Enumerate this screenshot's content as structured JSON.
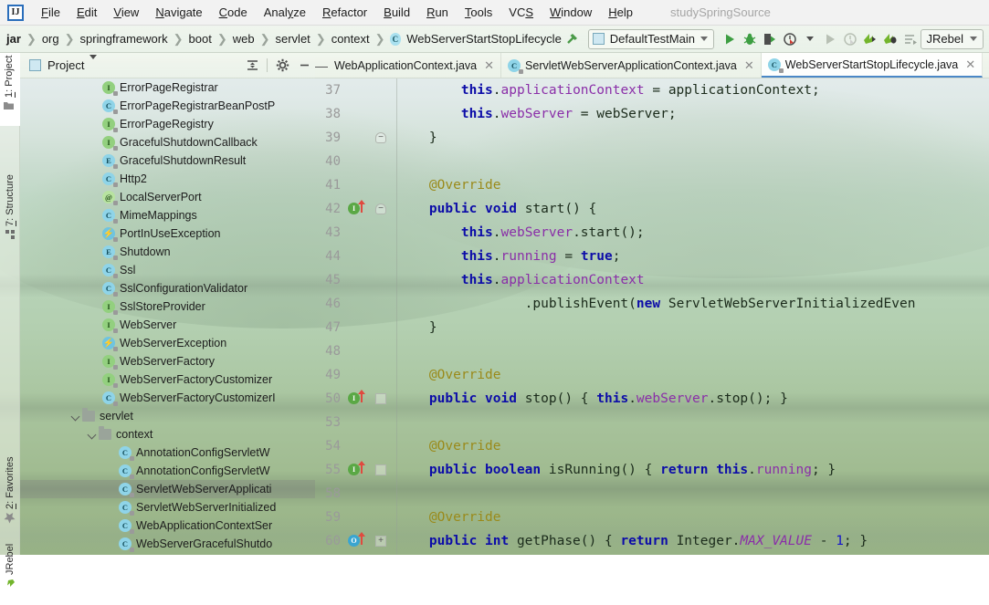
{
  "window": {
    "title": "studySpringSource",
    "logo_text": "IJ"
  },
  "menubar": {
    "items": [
      {
        "label": "File",
        "mnemonic": "F"
      },
      {
        "label": "Edit",
        "mnemonic": "E"
      },
      {
        "label": "View",
        "mnemonic": "V"
      },
      {
        "label": "Navigate",
        "mnemonic": "N"
      },
      {
        "label": "Code",
        "mnemonic": "C"
      },
      {
        "label": "Analyze",
        "mnemonic": "y"
      },
      {
        "label": "Refactor",
        "mnemonic": "R"
      },
      {
        "label": "Build",
        "mnemonic": "B"
      },
      {
        "label": "Run",
        "mnemonic": "R"
      },
      {
        "label": "Tools",
        "mnemonic": "T"
      },
      {
        "label": "VCS",
        "mnemonic": "S"
      },
      {
        "label": "Window",
        "mnemonic": "W"
      },
      {
        "label": "Help",
        "mnemonic": "H"
      }
    ]
  },
  "navbar": {
    "breadcrumbs": [
      "jar",
      "org",
      "springframework",
      "boot",
      "web",
      "servlet",
      "context"
    ],
    "current_file": "WebServerStartStopLifecycle",
    "current_file_icon": "C",
    "run_config": {
      "name": "DefaultTestMain",
      "icon": "run-config-icon"
    },
    "jrebel": {
      "label": "JRebel"
    },
    "buttons": [
      {
        "name": "build-hammer-icon",
        "label": "Build"
      },
      {
        "name": "run-button",
        "label": "Run"
      },
      {
        "name": "debug-button",
        "label": "Debug"
      },
      {
        "name": "run-coverage-button",
        "label": "Run with Coverage"
      },
      {
        "name": "profiler-button",
        "label": "Profiler"
      },
      {
        "name": "rerun-button",
        "label": "Rerun"
      },
      {
        "name": "attach-profiler-button",
        "label": "Attach Profiler"
      },
      {
        "name": "jrebel-run-button",
        "label": "Run with JRebel"
      },
      {
        "name": "jrebel-debug-button",
        "label": "Debug with JRebel"
      },
      {
        "name": "stop-all-button",
        "label": "Stop"
      }
    ]
  },
  "stripe": {
    "buttons": [
      {
        "label": "1: Project",
        "mnemonic": "1",
        "icon": "project-icon",
        "active": true
      },
      {
        "label": "7: Structure",
        "mnemonic": "7",
        "icon": "structure-icon",
        "active": false
      },
      {
        "label": "2: Favorites",
        "mnemonic": "2",
        "icon": "star-icon",
        "active": false
      },
      {
        "label": "JRebel",
        "mnemonic": "",
        "icon": "jrebel-icon",
        "active": false
      }
    ]
  },
  "project_panel": {
    "title": "Project",
    "toolbar": [
      {
        "name": "collapse-all-icon",
        "label": "Collapse All"
      },
      {
        "name": "gear-icon",
        "label": "Settings"
      },
      {
        "name": "hide-icon",
        "label": "Hide"
      }
    ],
    "tree": [
      {
        "label": "ErrorPageRegistrar",
        "icon": "I",
        "indent": 5,
        "type": "interface"
      },
      {
        "label": "ErrorPageRegistrarBeanPostP",
        "icon": "C",
        "indent": 5,
        "type": "class"
      },
      {
        "label": "ErrorPageRegistry",
        "icon": "I",
        "indent": 5,
        "type": "interface"
      },
      {
        "label": "GracefulShutdownCallback",
        "icon": "I",
        "indent": 5,
        "type": "interface"
      },
      {
        "label": "GracefulShutdownResult",
        "icon": "E",
        "indent": 5,
        "type": "enum"
      },
      {
        "label": "Http2",
        "icon": "C",
        "indent": 5,
        "type": "class"
      },
      {
        "label": "LocalServerPort",
        "icon": "@",
        "indent": 5,
        "type": "annotation"
      },
      {
        "label": "MimeMappings",
        "icon": "C",
        "indent": 5,
        "type": "class"
      },
      {
        "label": "PortInUseException",
        "icon": "X",
        "indent": 5,
        "type": "exception"
      },
      {
        "label": "Shutdown",
        "icon": "E",
        "indent": 5,
        "type": "enum"
      },
      {
        "label": "Ssl",
        "icon": "C",
        "indent": 5,
        "type": "class"
      },
      {
        "label": "SslConfigurationValidator",
        "icon": "C",
        "indent": 5,
        "type": "class"
      },
      {
        "label": "SslStoreProvider",
        "icon": "I",
        "indent": 5,
        "type": "interface"
      },
      {
        "label": "WebServer",
        "icon": "I",
        "indent": 5,
        "type": "interface"
      },
      {
        "label": "WebServerException",
        "icon": "X",
        "indent": 5,
        "type": "exception"
      },
      {
        "label": "WebServerFactory",
        "icon": "I",
        "indent": 5,
        "type": "interface"
      },
      {
        "label": "WebServerFactoryCustomizer",
        "icon": "I",
        "indent": 5,
        "type": "interface"
      },
      {
        "label": "WebServerFactoryCustomizerI",
        "icon": "C",
        "indent": 5,
        "type": "class"
      },
      {
        "label": "servlet",
        "icon": "folder",
        "indent": 3,
        "type": "folder",
        "expanded": true
      },
      {
        "label": "context",
        "icon": "folder",
        "indent": 4,
        "type": "folder",
        "expanded": true
      },
      {
        "label": "AnnotationConfigServletW",
        "icon": "C",
        "indent": 6,
        "type": "class"
      },
      {
        "label": "AnnotationConfigServletW",
        "icon": "C",
        "indent": 6,
        "type": "class"
      },
      {
        "label": "ServletWebServerApplicati",
        "icon": "C",
        "indent": 6,
        "type": "class",
        "selected": true
      },
      {
        "label": "ServletWebServerInitialized",
        "icon": "C",
        "indent": 6,
        "type": "class"
      },
      {
        "label": "WebApplicationContextSer",
        "icon": "C",
        "indent": 6,
        "type": "class"
      },
      {
        "label": "WebServerGracefulShutdo",
        "icon": "C",
        "indent": 6,
        "type": "class"
      }
    ]
  },
  "editor": {
    "tabs": [
      {
        "label": "WebApplicationContext.java",
        "icon": "",
        "active": false,
        "closeable": true
      },
      {
        "label": "ServletWebServerApplicationContext.java",
        "icon": "C",
        "active": false,
        "closeable": true
      },
      {
        "label": "WebServerStartStopLifecycle.java",
        "icon": "C",
        "active": true,
        "closeable": true
      },
      {
        "label": "",
        "icon": "I",
        "active": false,
        "closeable": false
      }
    ],
    "lines": [
      {
        "num": "37",
        "marker": "",
        "fold": "",
        "tokens": [
          {
            "t": "        ",
            "c": "pl"
          },
          {
            "t": "this",
            "c": "k"
          },
          {
            "t": ".",
            "c": "pl"
          },
          {
            "t": "applicationContext",
            "c": "fld"
          },
          {
            "t": " = applicationContext;",
            "c": "pl"
          }
        ]
      },
      {
        "num": "38",
        "marker": "",
        "fold": "",
        "tokens": [
          {
            "t": "        ",
            "c": "pl"
          },
          {
            "t": "this",
            "c": "k"
          },
          {
            "t": ".",
            "c": "pl"
          },
          {
            "t": "webServer",
            "c": "fld"
          },
          {
            "t": " = webServer;",
            "c": "pl"
          }
        ]
      },
      {
        "num": "39",
        "marker": "",
        "fold": "end",
        "tokens": [
          {
            "t": "    }",
            "c": "pl"
          }
        ]
      },
      {
        "num": "40",
        "marker": "",
        "fold": "",
        "tokens": [
          {
            "t": "",
            "c": "pl"
          }
        ]
      },
      {
        "num": "41",
        "marker": "",
        "fold": "",
        "tokens": [
          {
            "t": "    ",
            "c": "pl"
          },
          {
            "t": "@Override",
            "c": "ann"
          }
        ]
      },
      {
        "num": "42",
        "marker": "impl",
        "fold": "end",
        "tokens": [
          {
            "t": "    ",
            "c": "pl"
          },
          {
            "t": "public void ",
            "c": "k"
          },
          {
            "t": "start() {",
            "c": "pl"
          }
        ]
      },
      {
        "num": "43",
        "marker": "",
        "fold": "",
        "tokens": [
          {
            "t": "        ",
            "c": "pl"
          },
          {
            "t": "this",
            "c": "k"
          },
          {
            "t": ".",
            "c": "pl"
          },
          {
            "t": "webServer",
            "c": "fld"
          },
          {
            "t": ".start();",
            "c": "pl"
          }
        ]
      },
      {
        "num": "44",
        "marker": "",
        "fold": "",
        "tokens": [
          {
            "t": "        ",
            "c": "pl"
          },
          {
            "t": "this",
            "c": "k"
          },
          {
            "t": ".",
            "c": "pl"
          },
          {
            "t": "running",
            "c": "fld"
          },
          {
            "t": " = ",
            "c": "pl"
          },
          {
            "t": "true",
            "c": "k"
          },
          {
            "t": ";",
            "c": "pl"
          }
        ]
      },
      {
        "num": "45",
        "marker": "",
        "fold": "",
        "tokens": [
          {
            "t": "        ",
            "c": "pl"
          },
          {
            "t": "this",
            "c": "k"
          },
          {
            "t": ".",
            "c": "pl"
          },
          {
            "t": "applicationContext",
            "c": "fld"
          }
        ]
      },
      {
        "num": "46",
        "marker": "",
        "fold": "",
        "tokens": [
          {
            "t": "                .publishEvent(",
            "c": "pl"
          },
          {
            "t": "new",
            "c": "k"
          },
          {
            "t": " ServletWebServerInitializedEven",
            "c": "pl"
          }
        ]
      },
      {
        "num": "47",
        "marker": "",
        "fold": "",
        "tokens": [
          {
            "t": "    }",
            "c": "pl"
          }
        ]
      },
      {
        "num": "48",
        "marker": "",
        "fold": "",
        "tokens": [
          {
            "t": "",
            "c": "pl"
          }
        ]
      },
      {
        "num": "49",
        "marker": "",
        "fold": "",
        "tokens": [
          {
            "t": "    ",
            "c": "pl"
          },
          {
            "t": "@Override",
            "c": "ann"
          }
        ]
      },
      {
        "num": "50",
        "marker": "impl",
        "fold": "box",
        "tokens": [
          {
            "t": "    ",
            "c": "pl"
          },
          {
            "t": "public void ",
            "c": "k"
          },
          {
            "t": "stop() { ",
            "c": "pl"
          },
          {
            "t": "this",
            "c": "k"
          },
          {
            "t": ".",
            "c": "pl"
          },
          {
            "t": "webServer",
            "c": "fld"
          },
          {
            "t": ".stop(); }",
            "c": "pl"
          }
        ]
      },
      {
        "num": "53",
        "marker": "",
        "fold": "",
        "tokens": [
          {
            "t": "",
            "c": "pl"
          }
        ]
      },
      {
        "num": "54",
        "marker": "",
        "fold": "",
        "tokens": [
          {
            "t": "    ",
            "c": "pl"
          },
          {
            "t": "@Override",
            "c": "ann"
          }
        ]
      },
      {
        "num": "55",
        "marker": "impl",
        "fold": "box",
        "tokens": [
          {
            "t": "    ",
            "c": "pl"
          },
          {
            "t": "public boolean ",
            "c": "k"
          },
          {
            "t": "isRunning() { ",
            "c": "pl"
          },
          {
            "t": "return ",
            "c": "k"
          },
          {
            "t": "this",
            "c": "k"
          },
          {
            "t": ".",
            "c": "pl"
          },
          {
            "t": "running",
            "c": "fld"
          },
          {
            "t": "; }",
            "c": "pl"
          }
        ]
      },
      {
        "num": "58",
        "marker": "",
        "fold": "",
        "tokens": [
          {
            "t": "",
            "c": "pl"
          }
        ]
      },
      {
        "num": "59",
        "marker": "",
        "fold": "",
        "tokens": [
          {
            "t": "    ",
            "c": "pl"
          },
          {
            "t": "@Override",
            "c": "ann"
          }
        ]
      },
      {
        "num": "60",
        "marker": "over",
        "fold": "plus",
        "tokens": [
          {
            "t": "    ",
            "c": "pl"
          },
          {
            "t": "public int ",
            "c": "k"
          },
          {
            "t": "getPhase() { ",
            "c": "pl"
          },
          {
            "t": "return ",
            "c": "k"
          },
          {
            "t": "Integer.",
            "c": "pl"
          },
          {
            "t": "MAX_VALUE",
            "c": "stat"
          },
          {
            "t": " - ",
            "c": "pl"
          },
          {
            "t": "1",
            "c": "num"
          },
          {
            "t": "; }",
            "c": "pl"
          }
        ]
      }
    ]
  },
  "colors": {
    "accent": "#4a88c7",
    "keyword": "#0c0ca8",
    "field": "#8a2ea8",
    "annotation": "#9a8a1a",
    "class_icon": "#8fd4e8",
    "interface_icon": "#93d07f",
    "run_green": "#3d9e42"
  }
}
